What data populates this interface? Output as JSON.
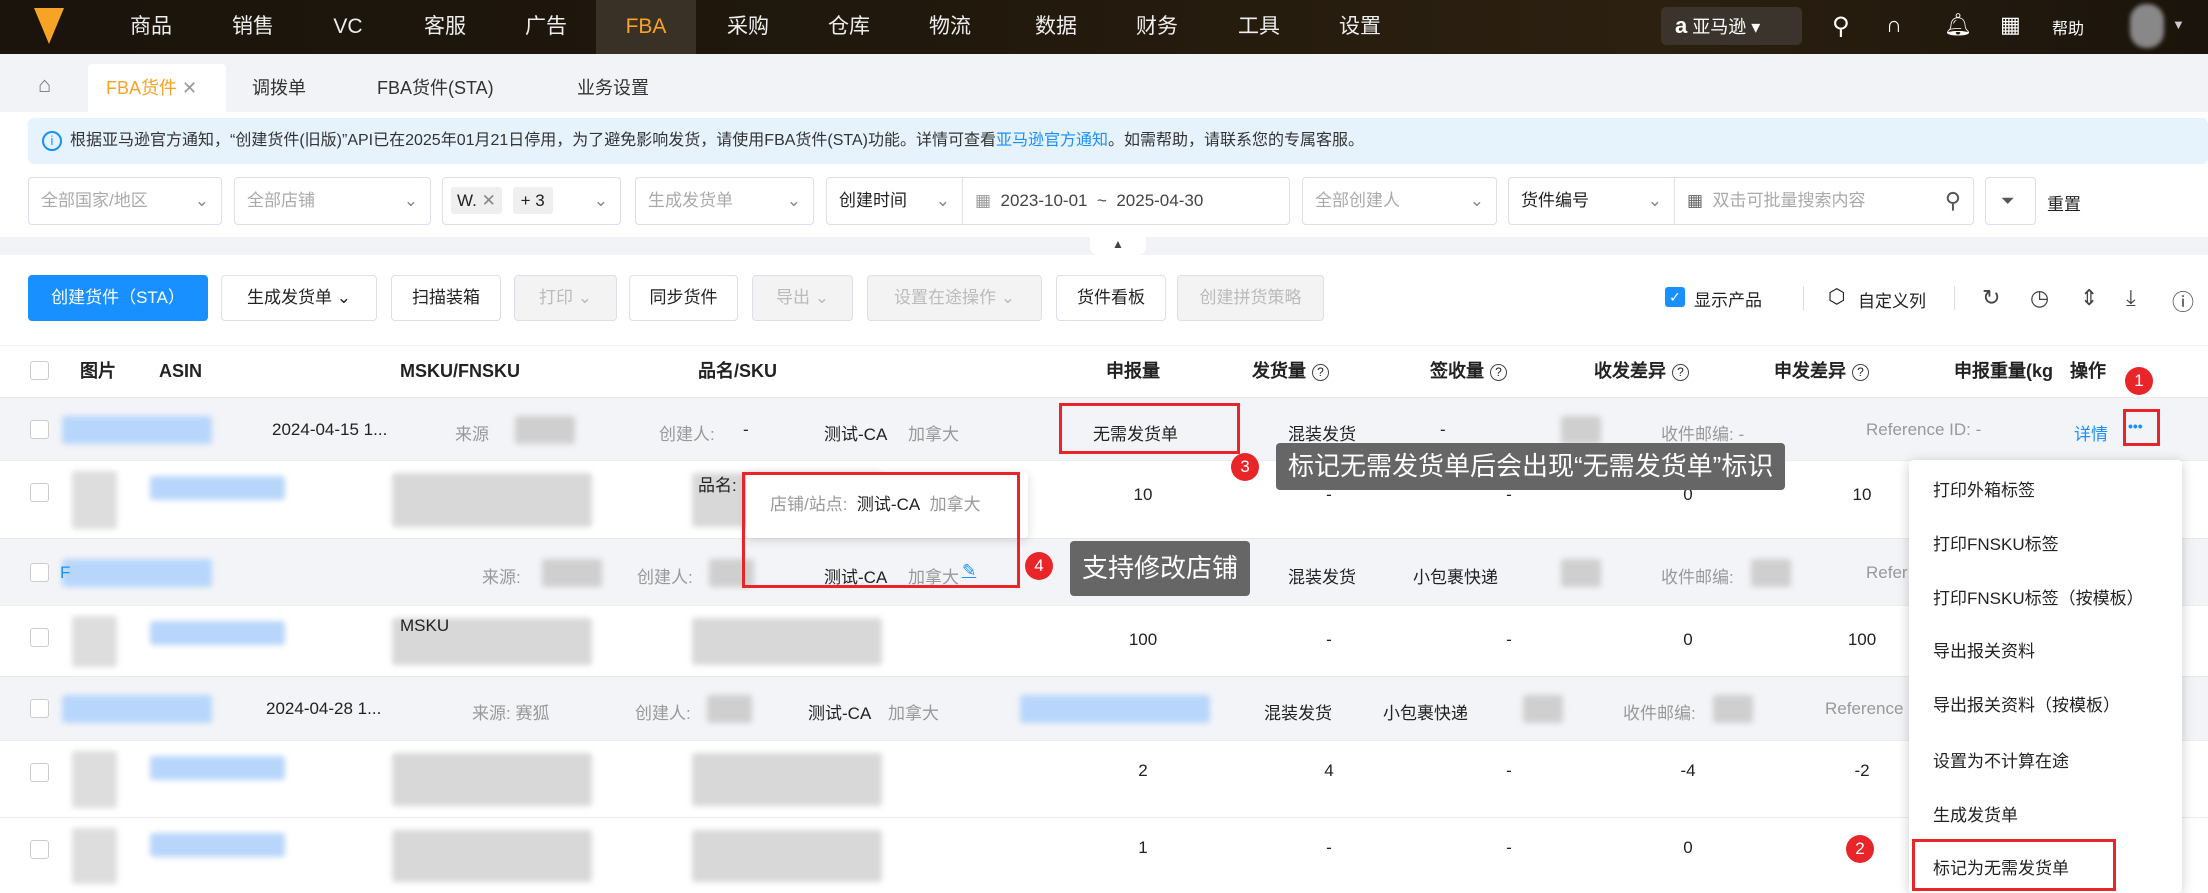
{
  "nav": {
    "items": [
      "商品",
      "销售",
      "VC",
      "客服",
      "广告",
      "FBA",
      "采购",
      "仓库",
      "物流",
      "数据",
      "财务",
      "工具",
      "设置"
    ],
    "active": "FBA",
    "platform": "亚马逊",
    "help": "帮助"
  },
  "tabs": [
    {
      "label": "FBA货件",
      "active": true
    },
    {
      "label": "调拨单"
    },
    {
      "label": "FBA货件(STA)"
    },
    {
      "label": "业务设置"
    }
  ],
  "notice": {
    "text": "根据亚马逊官方通知，“创建货件(旧版)”API已在2025年01月21日停用，为了避免影响发货，请使用FBA货件(STA)功能。详情可查看",
    "link": "亚马逊官方通知",
    "tail": "。如需帮助，请联系您的专属客服。"
  },
  "filters": {
    "country": "全部国家/地区",
    "shop": "全部店铺",
    "tag1": "W.",
    "tag_more": "+ 3",
    "gen": "生成发货单",
    "time_type": "创建时间",
    "date_start": "2023-10-01",
    "date_sep": "~",
    "date_end": "2025-04-30",
    "creator": "全部创建人",
    "search_type": "货件编号",
    "search_placeholder": "双击可批量搜索内容",
    "reset": "重置"
  },
  "toolbar": {
    "create": "创建货件（STA）",
    "gen": "生成发货单",
    "scan": "扫描装箱",
    "print": "打印",
    "sync": "同步货件",
    "export": "导出",
    "transit": "设置在途操作",
    "board": "货件看板",
    "strategy": "创建拼货策略",
    "show_product": "显示产品",
    "custom_cols": "自定义列"
  },
  "columns": [
    "图片",
    "ASIN",
    "MSKU/FNSKU",
    "品名/SKU",
    "申报量",
    "发货量",
    "签收量",
    "收发差异",
    "申发差异",
    "申报重量(kg",
    "操作"
  ],
  "groups": [
    {
      "date": "2024-04-15 1...",
      "source": "来源",
      "creator": "创建人:",
      "creator_val": "-",
      "shop": "测试-CA",
      "site": "加拿大",
      "tag": "无需发货单",
      "ship": "混装发货",
      "carrier": "-",
      "zip": "收件邮编: -",
      "ref": "Reference ID: -",
      "detail": "详情",
      "more": "•••"
    },
    {
      "fba": "F",
      "source": "来源:",
      "creator": "创建人:",
      "shop": "测试-CA",
      "site": "加拿大",
      "ship": "混装发货",
      "carrier": "小包裹快递",
      "zip": "收件邮编:",
      "ref": "Refer"
    },
    {
      "date": "2024-04-28 1...",
      "source": "来源: 赛狐",
      "creator": "创建人:",
      "shop": "测试-CA",
      "site": "加拿大",
      "ship": "混装发货",
      "carrier": "小包裹快递",
      "zip": "收件邮编:",
      "ref": "Reference"
    }
  ],
  "details": [
    {
      "label": "品名:",
      "vals": [
        "10",
        "-",
        "-",
        "0",
        "10"
      ]
    },
    {
      "label": "MSKU",
      "vals": [
        "100",
        "-",
        "-",
        "0",
        "100"
      ]
    },
    {
      "vals": [
        "2",
        "4",
        "-",
        "-4",
        "-2"
      ]
    },
    {
      "vals": [
        "1",
        "-",
        "-",
        "0",
        ""
      ]
    }
  ],
  "popover": {
    "label": "店铺/站点:",
    "shop": "测试-CA",
    "site": "加拿大"
  },
  "menu": [
    "打印外箱标签",
    "打印FNSKU标签",
    "打印FNSKU标签（按模板）",
    "导出报关资料",
    "导出报关资料（按模板）",
    "设置为不计算在途",
    "生成发货单",
    "标记为无需发货单"
  ],
  "annotations": {
    "c1": "1",
    "c2": "2",
    "c3": "3",
    "c4": "4",
    "tip3": "标记无需发货单后会出现“无需发货单”标识",
    "tip4": "支持修改店铺"
  }
}
